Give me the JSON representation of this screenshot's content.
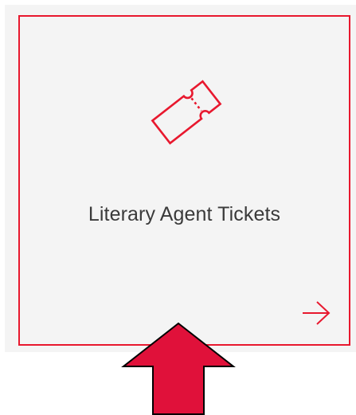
{
  "card": {
    "label": "Literary Agent Tickets",
    "icon": "ticket-icon",
    "action_icon": "arrow-right-icon"
  },
  "annotation": {
    "icon": "pointer-arrow-up-icon"
  },
  "colors": {
    "accent": "#e8182e",
    "pointer": "#e0113a",
    "card_background": "#f4f4f4",
    "label_text": "#3a3a3a"
  }
}
